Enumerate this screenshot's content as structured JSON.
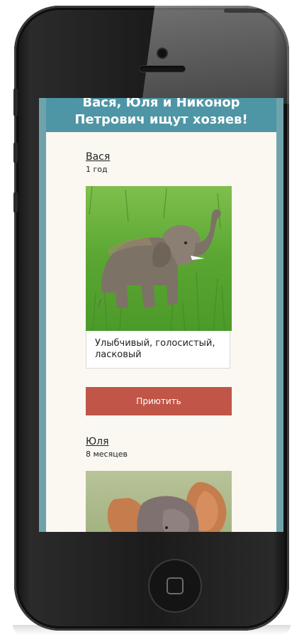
{
  "page": {
    "title": "Вася, Юля и Никонор Петрович ищут хозяев!"
  },
  "pets": [
    {
      "name": "Вася",
      "age": "1 год",
      "description": "Улыбчивый, голосистый, ласковый",
      "adopt_label": "Приютить"
    },
    {
      "name": "Юля",
      "age": "8 месяцев"
    }
  ],
  "colors": {
    "header_bg": "#4e95a6",
    "content_bg": "#faf8f1",
    "button_bg": "#c05548",
    "phone_body": "#1b1b1b"
  },
  "icons": {
    "home_button": "home-square-icon"
  }
}
